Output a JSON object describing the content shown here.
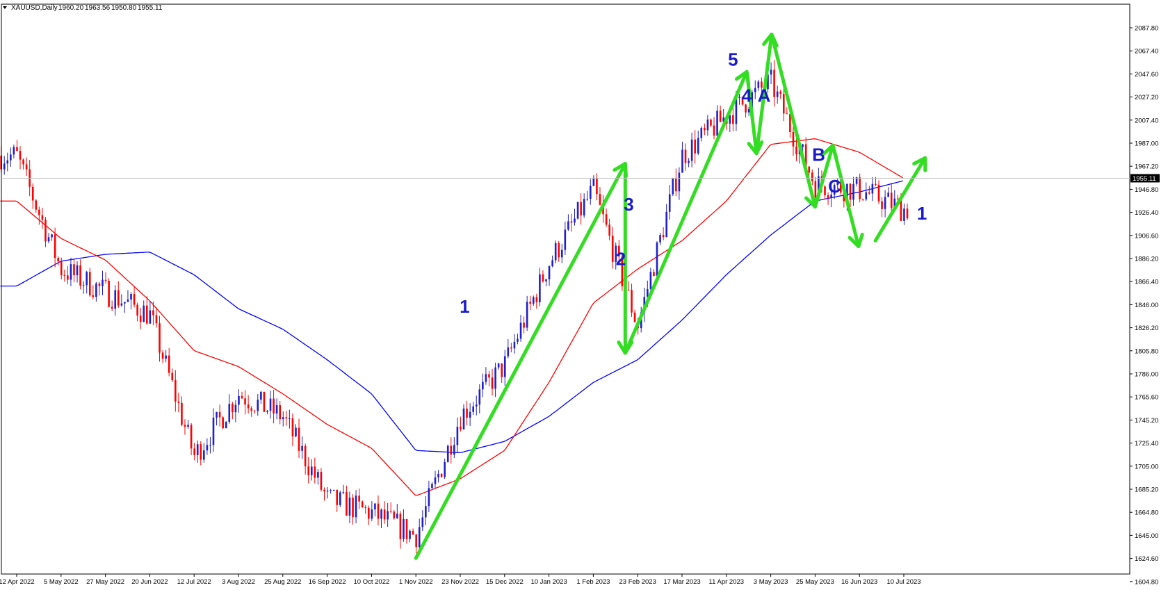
{
  "chart_data": {
    "type": "candlestick",
    "title": "XAUUSD,Daily",
    "ohlc_header": {
      "open": "1960.20",
      "high": "1963.56",
      "low": "1950.80",
      "close": "1955.11"
    },
    "current_price": 1955.11,
    "current_price_label": "1955.11",
    "ylim": [
      1604.8,
      2097.0
    ],
    "y_ticks": [
      "2087.80",
      "2067.40",
      "2047.60",
      "2027.20",
      "2007.40",
      "1987.00",
      "1967.20",
      "1946.80",
      "1926.40",
      "1906.60",
      "1886.20",
      "1866.40",
      "1846.00",
      "1826.20",
      "1805.80",
      "1786.00",
      "1765.60",
      "1745.20",
      "1725.40",
      "1705.00",
      "1685.20",
      "1664.80",
      "1645.00",
      "1624.60",
      "1604.80"
    ],
    "x_ticks": [
      "12 Apr 2022",
      "5 May 2022",
      "27 May 2022",
      "20 Jun 2022",
      "12 Jul 2022",
      "3 Aug 2022",
      "25 Aug 2022",
      "16 Sep 2022",
      "10 Oct 2022",
      "1 Nov 2022",
      "23 Nov 2022",
      "15 Dec 2022",
      "10 Jan 2023",
      "1 Feb 2023",
      "23 Feb 2023",
      "17 Mar 2023",
      "11 Apr 2023",
      "3 May 2023",
      "25 May 2023",
      "16 Jun 2023",
      "10 Jul 2023"
    ],
    "price_anchors": {
      "dates": [
        "12 Apr 2022",
        "5 May 2022",
        "27 May 2022",
        "20 Jun 2022",
        "12 Jul 2022",
        "3 Aug 2022",
        "25 Aug 2022",
        "16 Sep 2022",
        "10 Oct 2022",
        "1 Nov 2022",
        "23 Nov 2022",
        "15 Dec 2022",
        "10 Jan 2023",
        "1 Feb 2023",
        "23 Feb 2023",
        "17 Mar 2023",
        "11 Apr 2023",
        "3 May 2023",
        "25 May 2023",
        "16 Jun 2023",
        "10 Jul 2023"
      ],
      "close": [
        1975,
        1875,
        1855,
        1835,
        1710,
        1765,
        1745,
        1672,
        1660,
        1640,
        1745,
        1790,
        1880,
        1945,
        1825,
        1975,
        2010,
        2040,
        1950,
        1945,
        1928
      ]
    },
    "ma_red": {
      "color": "#ff0000",
      "dates": [
        "12 Apr 2022",
        "5 May 2022",
        "27 May 2022",
        "20 Jun 2022",
        "12 Jul 2022",
        "3 Aug 2022",
        "25 Aug 2022",
        "16 Sep 2022",
        "10 Oct 2022",
        "1 Nov 2022",
        "23 Nov 2022",
        "15 Dec 2022",
        "10 Jan 2023",
        "1 Feb 2023",
        "23 Feb 2023",
        "17 Mar 2023",
        "11 Apr 2023",
        "3 May 2023",
        "25 May 2023",
        "16 Jun 2023",
        "10 Jul 2023"
      ],
      "values": [
        1935,
        1902,
        1883,
        1847,
        1803,
        1789,
        1765,
        1738,
        1717,
        1675,
        1690,
        1715,
        1775,
        1845,
        1875,
        1900,
        1935,
        1985,
        1990,
        1978,
        1955
      ]
    },
    "ma_blue": {
      "color": "#0000ff",
      "dates": [
        "12 Apr 2022",
        "5 May 2022",
        "27 May 2022",
        "20 Jun 2022",
        "12 Jul 2022",
        "3 Aug 2022",
        "25 Aug 2022",
        "16 Sep 2022",
        "10 Oct 2022",
        "1 Nov 2022",
        "23 Nov 2022",
        "15 Dec 2022",
        "10 Jan 2023",
        "1 Feb 2023",
        "23 Feb 2023",
        "17 Mar 2023",
        "11 Apr 2023",
        "3 May 2023",
        "25 May 2023",
        "16 Jun 2023",
        "10 Jul 2023"
      ],
      "values": [
        1860,
        1882,
        1888,
        1890,
        1870,
        1840,
        1822,
        1795,
        1765,
        1715,
        1713,
        1723,
        1745,
        1775,
        1795,
        1830,
        1870,
        1905,
        1935,
        1943,
        1953
      ]
    },
    "wave_path": {
      "color": "#33dd22",
      "dates": [
        "1 Nov 2022",
        "1 Feb 2023",
        "23 Feb 2023",
        "11 Apr 2023",
        "3 May 2023",
        "3 May 2023",
        "25 May 2023",
        "25 May 2023",
        "16 Jun 2023",
        "16 Jun 2023"
      ],
      "values": [
        1620,
        1968,
        1801,
        2049,
        1977,
        2082,
        1930,
        1984,
        1895,
        1900
      ]
    },
    "wave_final_arrow": {
      "dates": [
        "16 Jun 2023",
        "10 Jul 2023"
      ],
      "values": [
        1900,
        1973
      ]
    },
    "wave_labels": [
      {
        "text": "1",
        "date": "23 Nov 2022",
        "price": 1842
      },
      {
        "text": "2",
        "date": "1 Feb 2023",
        "price": 1884
      },
      {
        "text": "3",
        "date": "23 Feb 2023",
        "price": 1932
      },
      {
        "text": "4",
        "date": "11 Apr 2023",
        "price": 2028
      },
      {
        "text": "5",
        "date": "11 Apr 2023",
        "price": 2060
      },
      {
        "text": "A",
        "date": "3 May 2023",
        "price": 2028
      },
      {
        "text": "B",
        "date": "25 May 2023",
        "price": 1976
      },
      {
        "text": "C",
        "date": "25 May 2023",
        "price": 1948
      },
      {
        "text": "1",
        "date": "10 Jul 2023",
        "price": 1924
      }
    ],
    "grid": false,
    "legend": "none"
  }
}
